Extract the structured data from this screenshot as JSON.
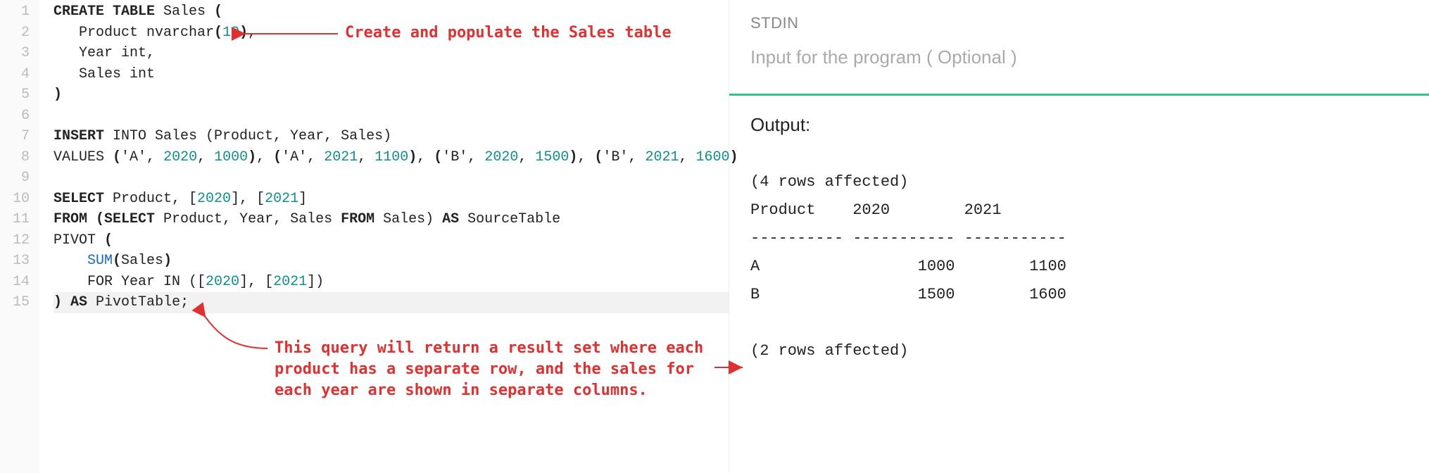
{
  "editor": {
    "line_count": 15,
    "lines": [
      {
        "n": 1,
        "segs": [
          {
            "t": "CREATE TABLE",
            "c": "bold"
          },
          {
            "t": " Sales "
          },
          {
            "t": "(",
            "c": "bold"
          }
        ]
      },
      {
        "n": 2,
        "segs": [
          {
            "t": "   Product nvarchar"
          },
          {
            "t": "(",
            "c": "bold"
          },
          {
            "t": "10",
            "c": "num"
          },
          {
            "t": ")",
            "c": "bold"
          },
          {
            "t": ","
          }
        ]
      },
      {
        "n": 3,
        "segs": [
          {
            "t": "   Year int,"
          }
        ]
      },
      {
        "n": 4,
        "segs": [
          {
            "t": "   Sales int"
          }
        ]
      },
      {
        "n": 5,
        "segs": [
          {
            "t": ")",
            "c": "bold"
          }
        ]
      },
      {
        "n": 6,
        "segs": [
          {
            "t": ""
          }
        ]
      },
      {
        "n": 7,
        "segs": [
          {
            "t": "INSERT",
            "c": "bold"
          },
          {
            "t": " INTO Sales (Product, Year, Sales)"
          }
        ]
      },
      {
        "n": 8,
        "segs": [
          {
            "t": "VALUES "
          },
          {
            "t": "(",
            "c": "bold"
          },
          {
            "t": "'A'"
          },
          {
            "t": ", "
          },
          {
            "t": "2020",
            "c": "num"
          },
          {
            "t": ", "
          },
          {
            "t": "1000",
            "c": "num"
          },
          {
            "t": ")",
            "c": "bold"
          },
          {
            "t": ", "
          },
          {
            "t": "(",
            "c": "bold"
          },
          {
            "t": "'A'"
          },
          {
            "t": ", "
          },
          {
            "t": "2021",
            "c": "num"
          },
          {
            "t": ", "
          },
          {
            "t": "1100",
            "c": "num"
          },
          {
            "t": ")",
            "c": "bold"
          },
          {
            "t": ", "
          },
          {
            "t": "(",
            "c": "bold"
          },
          {
            "t": "'B'"
          },
          {
            "t": ", "
          },
          {
            "t": "2020",
            "c": "num"
          },
          {
            "t": ", "
          },
          {
            "t": "1500",
            "c": "num"
          },
          {
            "t": ")",
            "c": "bold"
          },
          {
            "t": ", "
          },
          {
            "t": "(",
            "c": "bold"
          },
          {
            "t": "'B'"
          },
          {
            "t": ", "
          },
          {
            "t": "2021",
            "c": "num"
          },
          {
            "t": ", "
          },
          {
            "t": "1600",
            "c": "num"
          },
          {
            "t": ")",
            "c": "bold"
          }
        ]
      },
      {
        "n": 9,
        "segs": [
          {
            "t": ""
          }
        ]
      },
      {
        "n": 10,
        "segs": [
          {
            "t": "SELECT",
            "c": "bold"
          },
          {
            "t": " Product, ["
          },
          {
            "t": "2020",
            "c": "num"
          },
          {
            "t": "], ["
          },
          {
            "t": "2021",
            "c": "num"
          },
          {
            "t": "]"
          }
        ]
      },
      {
        "n": 11,
        "segs": [
          {
            "t": "FROM",
            "c": "bold"
          },
          {
            "t": " "
          },
          {
            "t": "(SELECT",
            "c": "bold"
          },
          {
            "t": " Product, Year, Sales "
          },
          {
            "t": "FROM",
            "c": "bold"
          },
          {
            "t": " Sales) "
          },
          {
            "t": "AS",
            "c": "bold"
          },
          {
            "t": " SourceTable"
          }
        ]
      },
      {
        "n": 12,
        "segs": [
          {
            "t": "PIVOT "
          },
          {
            "t": "(",
            "c": "bold"
          }
        ]
      },
      {
        "n": 13,
        "segs": [
          {
            "t": "    "
          },
          {
            "t": "SUM",
            "c": "func"
          },
          {
            "t": "(",
            "c": "bold"
          },
          {
            "t": "Sales"
          },
          {
            "t": ")",
            "c": "bold"
          }
        ]
      },
      {
        "n": 14,
        "segs": [
          {
            "t": "    FOR Year IN (["
          },
          {
            "t": "2020",
            "c": "num"
          },
          {
            "t": "], ["
          },
          {
            "t": "2021",
            "c": "num"
          },
          {
            "t": "])"
          }
        ]
      },
      {
        "n": 15,
        "segs": [
          {
            "t": ")",
            "c": "bold"
          },
          {
            "t": " "
          },
          {
            "t": "AS",
            "c": "bold"
          },
          {
            "t": " PivotTable;"
          }
        ],
        "hl": true
      }
    ]
  },
  "annotations": {
    "top": "Create and populate the Sales table",
    "bottom_l1": "This query will return a result set where each",
    "bottom_l2": "product has a separate row, and the sales for",
    "bottom_l3": "each year are shown in separate columns."
  },
  "stdin": {
    "label": "STDIN",
    "placeholder": "Input for the program ( Optional )"
  },
  "output": {
    "label": "Output:",
    "text": "(4 rows affected)\nProduct    2020        2021\n---------- ----------- -----------\nA                 1000        1100\nB                 1500        1600\n\n(2 rows affected)"
  }
}
